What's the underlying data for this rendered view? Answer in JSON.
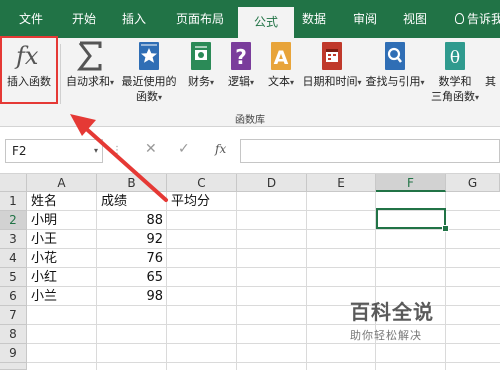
{
  "ribbon_tabs": [
    {
      "label": "文件"
    },
    {
      "label": "开始"
    },
    {
      "label": "插入"
    },
    {
      "label": "页面布局"
    },
    {
      "label": "公式",
      "active": true
    },
    {
      "label": "数据"
    },
    {
      "label": "审阅"
    },
    {
      "label": "视图"
    }
  ],
  "tell_me": "告诉我",
  "ribbon_buttons": {
    "insert_function": {
      "icon": "fx-icon",
      "label": "插入函数"
    },
    "autosum": {
      "icon": "sigma-icon",
      "line1": "自动求和",
      "dropdown": "▾"
    },
    "recently_used": {
      "icon": "star-book-icon",
      "line1": "最近使用的",
      "line2": "函数",
      "dropdown": "▾"
    },
    "financial": {
      "icon": "money-book-icon",
      "line1": "财务",
      "dropdown": "▾"
    },
    "logical": {
      "icon": "question-book-icon",
      "line1": "逻辑",
      "dropdown": "▾"
    },
    "text": {
      "icon": "a-book-icon",
      "line1": "文本",
      "dropdown": "▾"
    },
    "datetime": {
      "icon": "calendar-book-icon",
      "line1": "日期和时间",
      "dropdown": "▾"
    },
    "lookup": {
      "icon": "search-book-icon",
      "line1": "查找与引用",
      "dropdown": "▾"
    },
    "math": {
      "icon": "theta-book-icon",
      "line1": "数学和",
      "line2": "三角函数",
      "dropdown": "▾"
    },
    "more": {
      "line1": "其"
    }
  },
  "ribbon_group_label": "函数库",
  "formula_bar": {
    "name_box": "F2",
    "name_box_dropdown": "▾",
    "dots": "⋮",
    "cancel": "✕",
    "enter": "✓",
    "fx": "fx",
    "formula": ""
  },
  "sheet": {
    "columns": [
      "A",
      "B",
      "C",
      "D",
      "E",
      "F",
      "G"
    ],
    "selected_column": "F",
    "rows": [
      "1",
      "2",
      "3",
      "4",
      "5",
      "6",
      "7",
      "8",
      "9",
      "10"
    ],
    "selected_row": "2",
    "active_cell": "F2",
    "cells": {
      "A1": "姓名",
      "B1": "成绩",
      "C1": "平均分",
      "A2": "小明",
      "B2": "88",
      "A3": "小王",
      "B3": "92",
      "A4": "小花",
      "B4": "76",
      "A5": "小红",
      "B5": "65",
      "A6": "小兰",
      "B6": "98"
    }
  },
  "watermark": {
    "title": "百科全说",
    "subtitle": "助你轻松解决"
  },
  "colors": {
    "excel_green": "#217346",
    "highlight_red": "#e53935"
  }
}
